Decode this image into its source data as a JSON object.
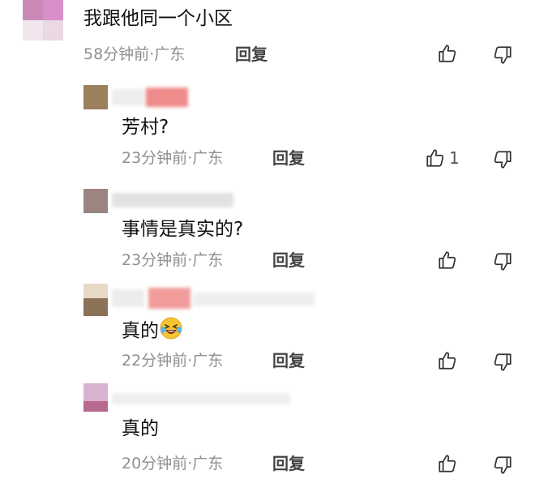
{
  "comments": [
    {
      "text": "我跟他同一个小区",
      "time": "58分钟前",
      "location": "广东",
      "reply_label": "回复",
      "likes": ""
    },
    {
      "text": "芳村?",
      "time": "23分钟前",
      "location": "广东",
      "reply_label": "回复",
      "likes": "1"
    },
    {
      "text": "事情是真实的?",
      "time": "23分钟前",
      "location": "广东",
      "reply_label": "回复",
      "likes": ""
    },
    {
      "text": "真的",
      "time": "22分钟前",
      "location": "广东",
      "reply_label": "回复",
      "likes": "",
      "emoji": "laughing-tears-emoji"
    },
    {
      "text": "真的",
      "time": "20分钟前",
      "location": "广东",
      "reply_label": "回复",
      "likes": ""
    }
  ],
  "icons": {
    "like": "thumbs-up-icon",
    "dislike": "thumbs-down-icon"
  },
  "colors": {
    "meta": "#8f8f8f",
    "text": "#111111"
  }
}
